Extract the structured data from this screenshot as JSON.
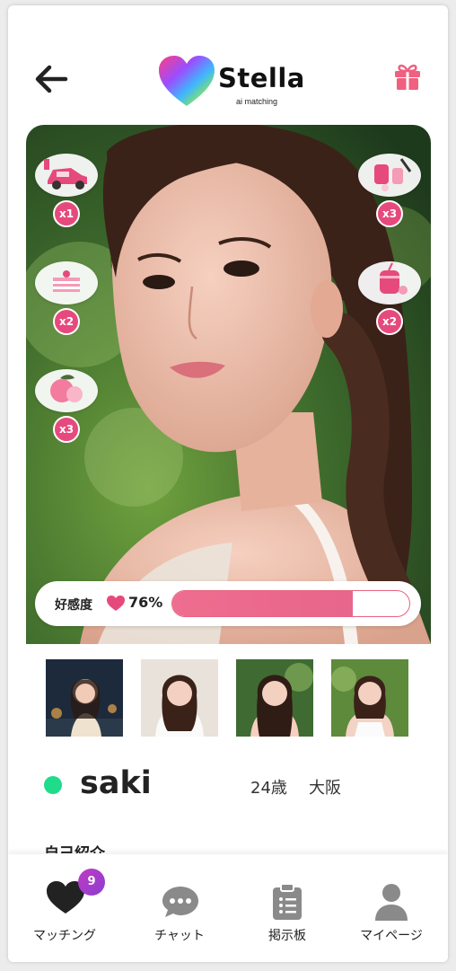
{
  "header": {
    "app_name": "Stella",
    "app_subtitle": "ai matching",
    "back_icon": "arrow-left-icon",
    "gift_icon": "gift-icon"
  },
  "gifts": {
    "left": [
      {
        "item": "car",
        "count": "x1"
      },
      {
        "item": "cake",
        "count": "x2"
      },
      {
        "item": "peach",
        "count": "x3"
      }
    ],
    "right": [
      {
        "item": "cosmetics",
        "count": "x3"
      },
      {
        "item": "drink",
        "count": "x2"
      }
    ]
  },
  "affinity": {
    "label": "好感度",
    "value_text": "76%",
    "value": 0.76,
    "fill_color": "#ee6a8c"
  },
  "profile": {
    "name": "saki",
    "age": "24歳",
    "city": "大阪",
    "online": true,
    "intro_heading": "自己紹介"
  },
  "nav": {
    "items": [
      {
        "label": "マッチング",
        "icon": "heart-icon",
        "badge": "9"
      },
      {
        "label": "チャット",
        "icon": "chat-icon"
      },
      {
        "label": "掲示板",
        "icon": "clipboard-icon"
      },
      {
        "label": "マイページ",
        "icon": "user-icon"
      }
    ]
  },
  "colors": {
    "accent": "#e64a7d",
    "online": "#1edc8a",
    "badge": "#9b3ccc"
  }
}
